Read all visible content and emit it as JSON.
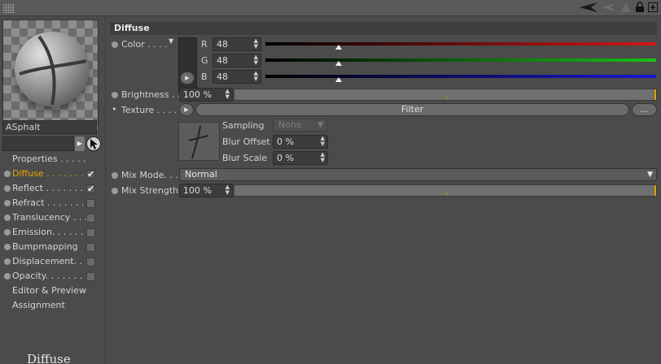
{
  "sidebar": {
    "material_name": "ASphalt",
    "channels": [
      {
        "label": "Properties . . . . .",
        "has_dot": false,
        "checkbox": "none",
        "active": false
      },
      {
        "label": "Diffuse . . . . . . . .",
        "has_dot": true,
        "checkbox": "checked",
        "active": true
      },
      {
        "label": "Reflect . . . . . . . .",
        "has_dot": true,
        "checkbox": "checked",
        "active": false
      },
      {
        "label": "Refract . . . . . . . .",
        "has_dot": true,
        "checkbox": "unchecked",
        "active": false
      },
      {
        "label": "Translucency . . .",
        "has_dot": true,
        "checkbox": "unchecked",
        "active": false
      },
      {
        "label": "Emission. . . . . . .",
        "has_dot": true,
        "checkbox": "unchecked",
        "active": false
      },
      {
        "label": "Bumpmapping",
        "has_dot": true,
        "checkbox": "unchecked",
        "active": false
      },
      {
        "label": "Displacement. . .",
        "has_dot": true,
        "checkbox": "unchecked",
        "active": false
      },
      {
        "label": "Opacity. . . . . . . .",
        "has_dot": true,
        "checkbox": "unchecked",
        "active": false
      },
      {
        "label": "Editor & Preview",
        "has_dot": false,
        "checkbox": "none",
        "active": false
      },
      {
        "label": "Assignment",
        "has_dot": false,
        "checkbox": "none",
        "active": false
      }
    ],
    "caption": "Diffuse Layer"
  },
  "panel": {
    "section_title": "Diffuse",
    "color": {
      "label": "Color . . . .",
      "swatch": "#303030",
      "channels": [
        {
          "name": "R",
          "value": "48",
          "level": 0.188,
          "color": "#d01818"
        },
        {
          "name": "G",
          "value": "48",
          "level": 0.188,
          "color": "#18c018"
        },
        {
          "name": "B",
          "value": "48",
          "level": 0.188,
          "color": "#1818d0"
        }
      ]
    },
    "brightness": {
      "label": "Brightness . .",
      "value": "100 %",
      "level": 1.0
    },
    "texture": {
      "label": "Texture . . . . .",
      "button": "Filter",
      "more": "...",
      "sampling_label": "Sampling",
      "sampling_value": "None",
      "blur_offset_label": "Blur Offset",
      "blur_offset_value": "0 %",
      "blur_scale_label": "Blur Scale",
      "blur_scale_value": "0 %"
    },
    "mix_mode": {
      "label": "Mix Mode. . . .",
      "value": "Normal"
    },
    "mix_strength": {
      "label": "Mix Strength",
      "value": "100 %",
      "level": 1.0
    }
  },
  "colors": {
    "accent": "#f0a500",
    "panel_bg": "#4b4b4b"
  }
}
